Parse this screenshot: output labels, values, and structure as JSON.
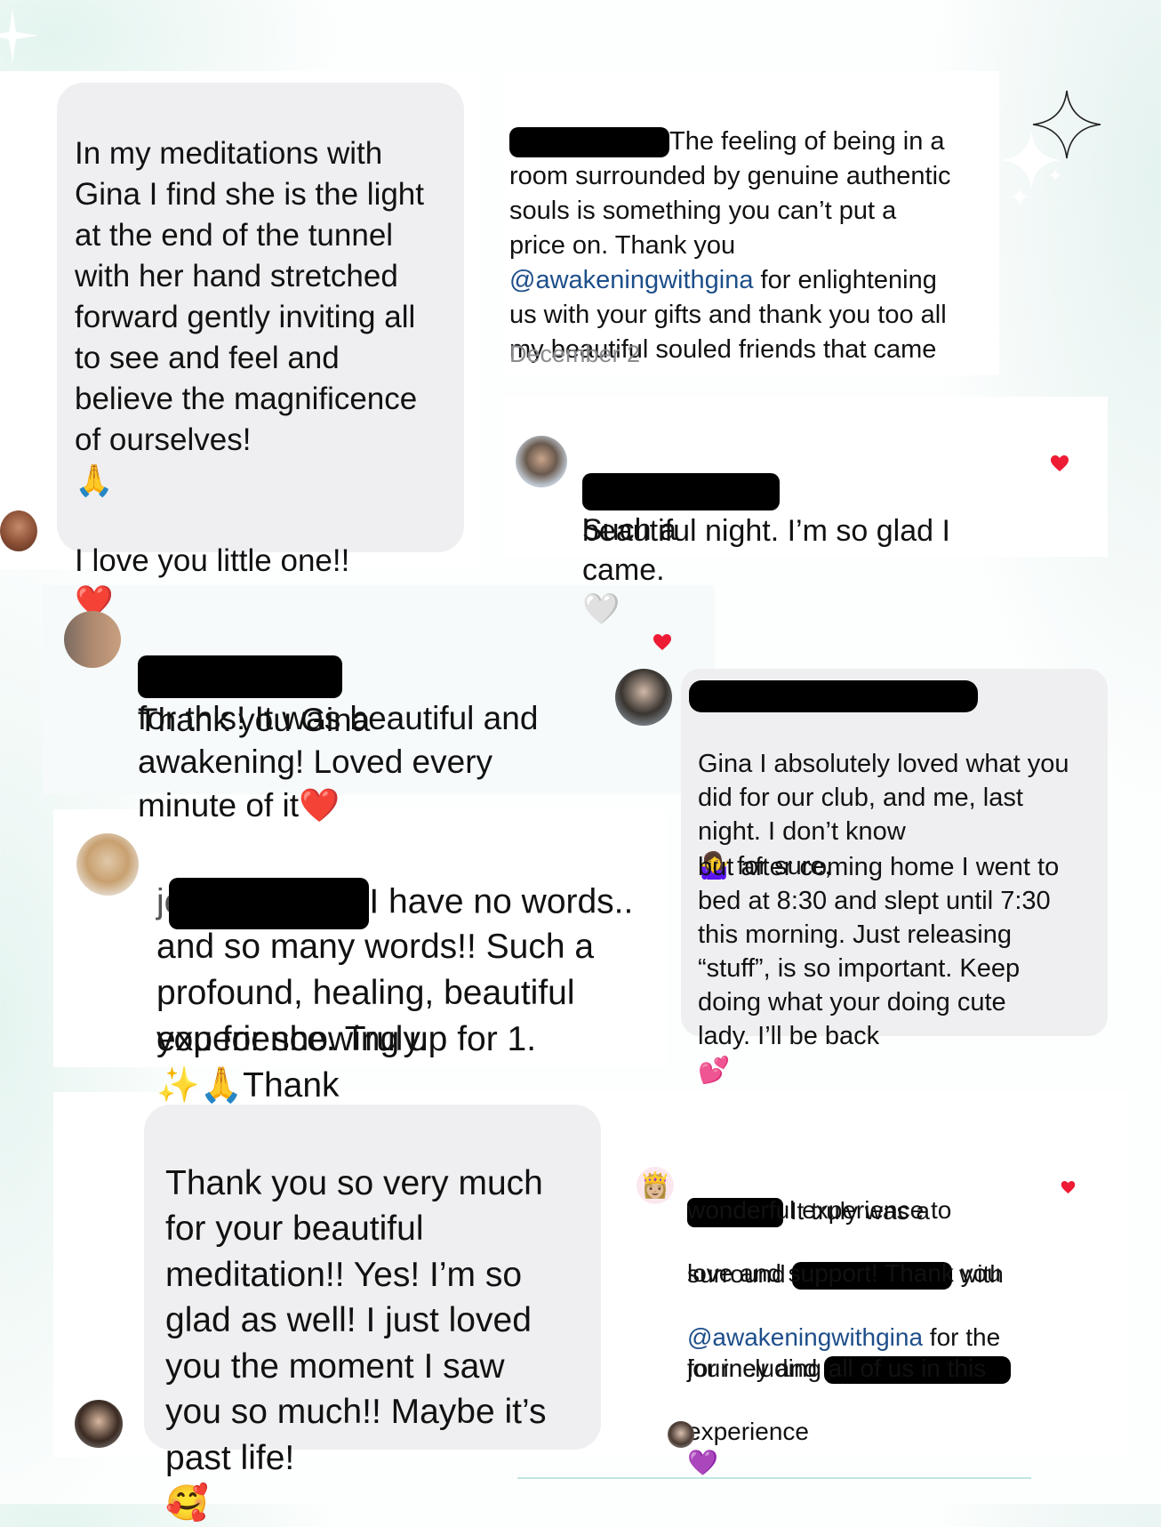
{
  "colors": {
    "bubble": "#efeff1",
    "heart": "#ee1b35",
    "mention": "#1d4e8a",
    "date": "#8a8a8e"
  },
  "c1": {
    "text": "In my meditations with\nGina I find she is the light\nat the end of the tunnel\nwith her hand stretched\nforward gently inviting all\nto see and feel and\nbelieve the magnificence\nof ourselves!",
    "emoji": "🙏",
    "love": "I love you little one!!",
    "love_emoji": "❤️",
    "avatar": "avatar-icon"
  },
  "c2": {
    "line1": "The feeling of being in a",
    "body_a": "room surrounded by genuine authentic\nsouls is something you can’t put a\nprice on. Thank you",
    "mention": "@awakeningwithgina",
    "body_b": " for enlightening",
    "body_c": "us with your gifts and thank you too all\nmy beautiful souled friends that came",
    "date": "December 2"
  },
  "c3": {
    "line1": "Such a",
    "rest": "beautiful night. I’m so glad I\ncame.",
    "emoji": "🤍",
    "heart_icon": "heart-icon"
  },
  "c4": {
    "line1": "Thank you Gina",
    "rest": "for this! It was beautiful and\nawakening! Loved every\nminute of it",
    "emoji": "❤️",
    "heart_icon": "heart-icon"
  },
  "c5": {
    "text": "Gina I absolutely loved what you\ndid for our club, and me, last\nnight.  I don’t know",
    "emoji1": "🤷‍♀️",
    "text_b": " for sure,",
    "text2": "but after coming home I went to\nbed at 8:30 and slept until 7:30\nthis morning.  Just releasing\n“stuff”, is so important.  Keep\ndoing what your doing cute\nlady.  I’ll be back",
    "emoji2": "💕"
  },
  "c6": {
    "prefix": "je",
    "line1": "I have no words..",
    "rest": "and so many words!! Such a\nprofound, healing, beautiful",
    "line4a": "experience. Truly.",
    "emoji": "✨🙏",
    "line4b": "Thank",
    "line5": "you for showing up for 1."
  },
  "c7": {
    "text": "Thank you so very much\nfor your beautiful\nmeditation!! Yes! I’m so\nglad as well! I just loved\nyou the moment I saw\nyou so much!! Maybe it’s\npast life!",
    "emoji": "🥰"
  },
  "c8": {
    "line1": "It truly was a",
    "line2": "wonderful experience to",
    "line3a": "surround",
    "line3b": "with",
    "line4": "love and support! Thank you",
    "mention": "@awakeningwithgina",
    "line5b": " for the",
    "line6a": "journey and",
    "line7": "for including all of us in this",
    "line8": "experience",
    "emoji": "💜",
    "heart_icon": "heart-icon",
    "avatar_emoji": "👸🏼"
  }
}
